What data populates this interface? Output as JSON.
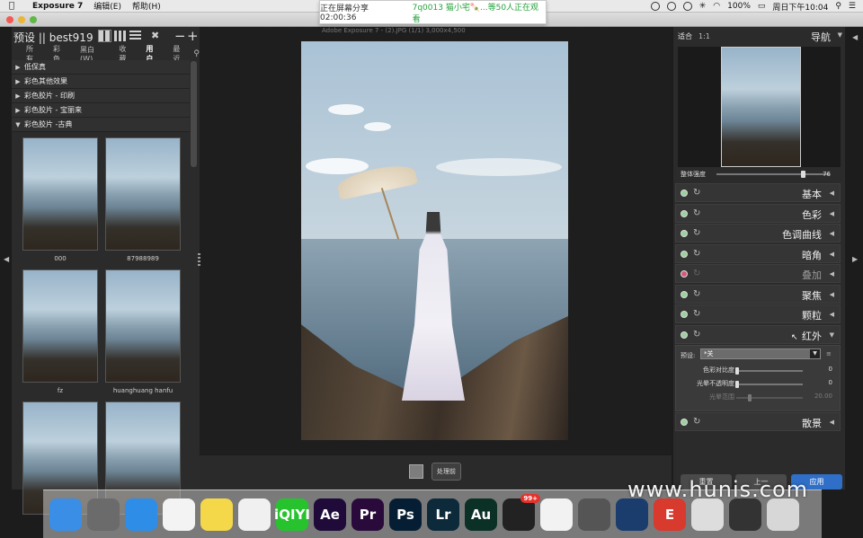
{
  "menubar": {
    "app_name": "Exposure 7",
    "menus": [
      "编辑(E)",
      "帮助(H)"
    ],
    "battery": "100%",
    "clock": "周日下午10:04"
  },
  "screen_share": {
    "status": "正在屏幕分享 02:00:36",
    "viewers": "7q0013 猫小宅🍡...等50人正在观看"
  },
  "window": {
    "title": "Adobe Exposure 7 - (2).JPG (1/1) 3,000x4,500"
  },
  "left_panel": {
    "title": "预设 || best919",
    "tabs": [
      "所有",
      "彩色",
      "黑白(W)",
      "收藏",
      "用户",
      "最近"
    ],
    "active_tab": "用户",
    "tree": [
      {
        "label": "低保真",
        "expanded": false
      },
      {
        "label": "彩色其他效果",
        "expanded": false
      },
      {
        "label": "彩色胶片 - 印刷",
        "expanded": false
      },
      {
        "label": "彩色胶片 - 宝丽来",
        "expanded": false
      },
      {
        "label": "彩色胶片 -古典",
        "expanded": true
      }
    ],
    "thumbnails": [
      {
        "label": "000"
      },
      {
        "label": "87988989"
      },
      {
        "label": "fz"
      },
      {
        "label": "huanghuang hanfu"
      },
      {
        "label": ""
      },
      {
        "label": ""
      }
    ]
  },
  "center": {
    "before_button": "处理前"
  },
  "right_panel": {
    "fit_label": "适合",
    "ratio_label": "1:1",
    "nav_title": "导航",
    "overall_strength_label": "整体强度",
    "overall_strength_value": "76",
    "overall_strength_fraction": 0.76,
    "sections": [
      {
        "title": "基本",
        "enabled": true
      },
      {
        "title": "色彩",
        "enabled": true
      },
      {
        "title": "色调曲线",
        "enabled": true
      },
      {
        "title": "暗角",
        "enabled": true
      },
      {
        "title": "叠加",
        "enabled": false
      },
      {
        "title": "聚焦",
        "enabled": true
      },
      {
        "title": "颗粒",
        "enabled": true
      },
      {
        "title": "红外",
        "enabled": true,
        "expanded": true
      }
    ],
    "infrared": {
      "preset_label": "预设:",
      "preset_value": "*关",
      "rows": [
        {
          "label": "色彩对比度",
          "value": "0",
          "dim": false
        },
        {
          "label": "光晕不透明度",
          "value": "0",
          "dim": false
        },
        {
          "label": "光晕范围",
          "value": "20.00",
          "dim": true
        }
      ]
    },
    "last_section": {
      "title": "散景",
      "enabled": true
    },
    "buttons": {
      "reset": "重置",
      "prev": "上一",
      "apply": "应用"
    }
  },
  "dock": {
    "items": [
      {
        "name": "finder",
        "label": "",
        "color": "#3a8ee6"
      },
      {
        "name": "launchpad",
        "label": "",
        "color": "#6b6b6b"
      },
      {
        "name": "safari",
        "label": "",
        "color": "#2e8de6"
      },
      {
        "name": "reminders",
        "label": "",
        "color": "#f3f3f3"
      },
      {
        "name": "notes",
        "label": "",
        "color": "#f4d84a"
      },
      {
        "name": "photos",
        "label": "",
        "color": "#f0f0f0"
      },
      {
        "name": "iqiyi",
        "label": "iQIYI",
        "color": "#26c32f"
      },
      {
        "name": "after-effects",
        "label": "Ae",
        "color": "#1f0a3a"
      },
      {
        "name": "premiere",
        "label": "Pr",
        "color": "#2a0a3a"
      },
      {
        "name": "photoshop",
        "label": "Ps",
        "color": "#061e33"
      },
      {
        "name": "lightroom",
        "label": "Lr",
        "color": "#0c2a3a"
      },
      {
        "name": "audition",
        "label": "Au",
        "color": "#0b3026"
      },
      {
        "name": "qq",
        "label": "",
        "color": "#222222",
        "badge": "99+"
      },
      {
        "name": "wechat",
        "label": "",
        "color": "#f2f2f2"
      },
      {
        "name": "image-capture",
        "label": "",
        "color": "#555555"
      },
      {
        "name": "quicktime",
        "label": "",
        "color": "#1b3d6e"
      },
      {
        "name": "exposure",
        "label": "E",
        "color": "#d83a2e"
      },
      {
        "name": "screen-app",
        "label": "",
        "color": "#dddddd"
      },
      {
        "name": "monitor-app",
        "label": "",
        "color": "#333333"
      },
      {
        "name": "trash",
        "label": "",
        "color": "#d7d7d7"
      }
    ],
    "watermark": "www.hunis.com"
  }
}
